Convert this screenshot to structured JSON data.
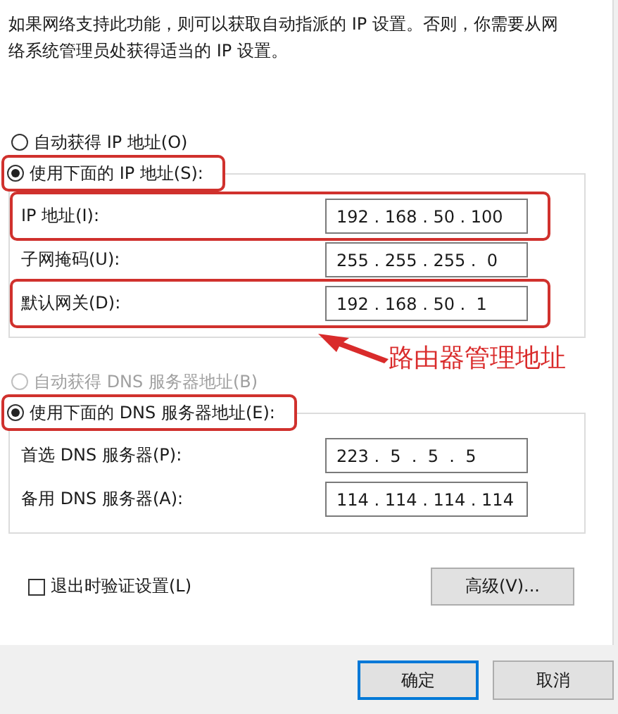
{
  "description": "如果网络支持此功能，则可以获取自动指派的 IP 设置。否则，你需要从网络系统管理员处获得适当的 IP 设置。",
  "ip_section": {
    "options": [
      {
        "label": "自动获得 IP 地址(O)",
        "selected": false,
        "disabled": false,
        "highlighted": false
      },
      {
        "label": "使用下面的 IP 地址(S):",
        "selected": true,
        "disabled": false,
        "highlighted": true
      }
    ],
    "fields": [
      {
        "label": "IP 地址(I):",
        "value": "192 . 168 . 50 . 100",
        "highlighted": true
      },
      {
        "label": "子网掩码(U):",
        "value": "255 . 255 . 255 .  0",
        "highlighted": false
      },
      {
        "label": "默认网关(D):",
        "value": "192 . 168 . 50 .  1",
        "highlighted": true
      }
    ]
  },
  "annotation": {
    "text": "路由器管理地址"
  },
  "dns_section": {
    "options": [
      {
        "label": "自动获得 DNS 服务器地址(B)",
        "selected": false,
        "disabled": true,
        "highlighted": false
      },
      {
        "label": "使用下面的 DNS 服务器地址(E):",
        "selected": true,
        "disabled": false,
        "highlighted": true
      }
    ],
    "fields": [
      {
        "label": "首选 DNS 服务器(P):",
        "value": "223 .  5  .  5  .  5",
        "highlighted": false
      },
      {
        "label": "备用 DNS 服务器(A):",
        "value": "114 . 114 . 114 . 114",
        "highlighted": false
      }
    ]
  },
  "validate_checkbox": {
    "label": "退出时验证设置(L)",
    "checked": false
  },
  "advanced_button": "高级(V)...",
  "buttons": [
    {
      "label": "确定",
      "default": true
    },
    {
      "label": "取消",
      "default": false
    }
  ]
}
